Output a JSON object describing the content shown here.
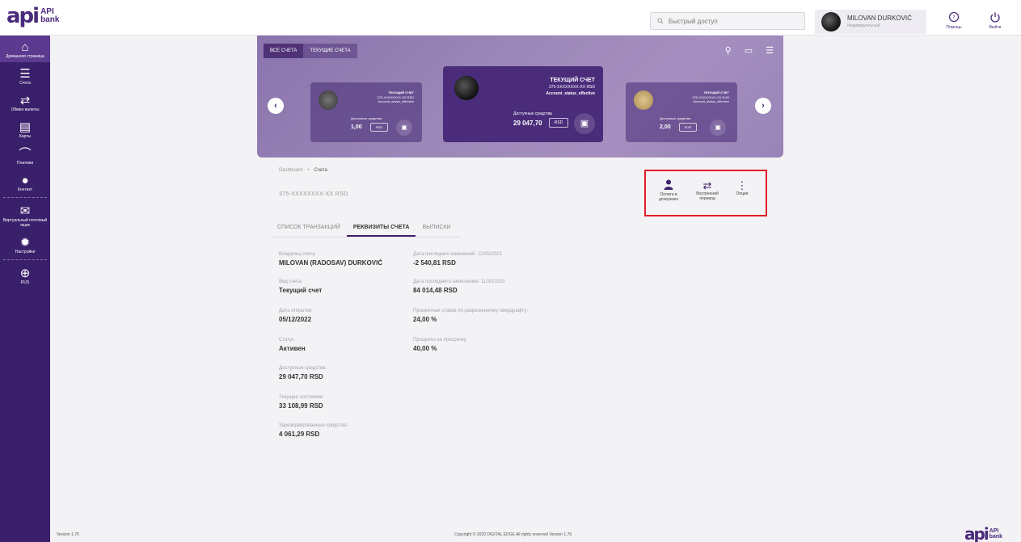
{
  "brand": {
    "mark": "api",
    "line1": "API",
    "line2": "bank"
  },
  "header": {
    "search_placeholder": "Быстрый доступ",
    "user_name": "MILOVAN DURKOVIĆ",
    "user_role": "Индивидуальный",
    "help_label": "Помощь",
    "logout_label": "Выйти"
  },
  "sidebar": {
    "items": [
      {
        "label": "Домашняя страница",
        "icon": "home-icon"
      },
      {
        "label": "Счета",
        "icon": "list-icon"
      },
      {
        "label": "Обмен валюты",
        "icon": "exchange-icon"
      },
      {
        "label": "Карты",
        "icon": "card-icon"
      },
      {
        "label": "Платежи",
        "icon": "payment-icon"
      },
      {
        "label": "Контакт",
        "icon": "contact-icon"
      },
      {
        "label": "Виртуальный почтовый ящик",
        "icon": "mail-icon"
      },
      {
        "label": "Настройки",
        "icon": "gear-icon"
      },
      {
        "label": "RUS",
        "icon": "globe-icon"
      }
    ]
  },
  "carousel": {
    "tabs": [
      "ВСЕ СЧЕТА",
      "ТЕКУЩИЕ СЧЕТА"
    ],
    "cards": [
      {
        "type": "ТЕКУЩИЙ СЧЕТ",
        "number": "375-XXXXXXXX-XX RSD",
        "status": "Account_status_effective",
        "avail_label": "Доступные средства",
        "amount": "1,00",
        "currency": "RSD"
      },
      {
        "type": "ТЕКУЩИЙ СЧЕТ",
        "number": "375-XXXXXXXX-XX RSD",
        "status": "Account_status_effective",
        "avail_label": "Доступные средства",
        "amount": "29 047,70",
        "currency": "RSD"
      },
      {
        "type": "ТЕКУЩИЙ СЧЕТ",
        "number": "375-XXXXXXXX-XX EUR",
        "status": "Account_status_effective",
        "avail_label": "Доступные средства",
        "amount": "2,00",
        "currency": "EUR"
      }
    ]
  },
  "breadcrumb": {
    "root": "Dashboard",
    "current": "Счета"
  },
  "account_number": "375-XXXXXXXX-XX RSD",
  "actions": [
    {
      "label": "Оплата в дочернюю",
      "icon": "person-icon"
    },
    {
      "label": "Внутренний перевод",
      "icon": "transfer-icon"
    },
    {
      "label": "Опции",
      "icon": "more-icon"
    }
  ],
  "tabs": [
    "СПИСОК ТРАНЗАКЦИЙ",
    "РЕКВИЗИТЫ СЧЕТА",
    "ВЫПИСКИ"
  ],
  "details": {
    "owner_label": "Владелец счета",
    "owner": "MILOVAN (RADOSAV) DURKOVIĆ",
    "type_label": "Вид счета",
    "type": "Текущий счет",
    "opened_label": "Дата открытия",
    "opened": "05/12/2022",
    "status_label": "Статус",
    "status": "Активен",
    "available_label": "Доступные средства:",
    "available": "29 047,70 RSD",
    "current_label": "Текущее состояние:",
    "current": "33 108,99 RSD",
    "reserved_label": "Зарезервированные средства:",
    "reserved": "4 061,29 RSD",
    "last_change_label": "Дата последних изменений: 12/05/2023",
    "last_change": "-2 540,81 RSD",
    "last_credit_label": "Дата последнего зачисления: 11/30/2023",
    "last_credit": "84 014,48 RSD",
    "overdraft_rate_label": "Процентная ставка по разрешенному овердрафту:",
    "overdraft_rate": "24,00 %",
    "overdue_rate_label": "Проценты за просрочку",
    "overdue_rate": "40,00 %"
  },
  "footer": {
    "version": "Version 1.76",
    "copyright": "Copyright © 2020 DIGITAL EDGE All rights reserved Version 1.76"
  }
}
